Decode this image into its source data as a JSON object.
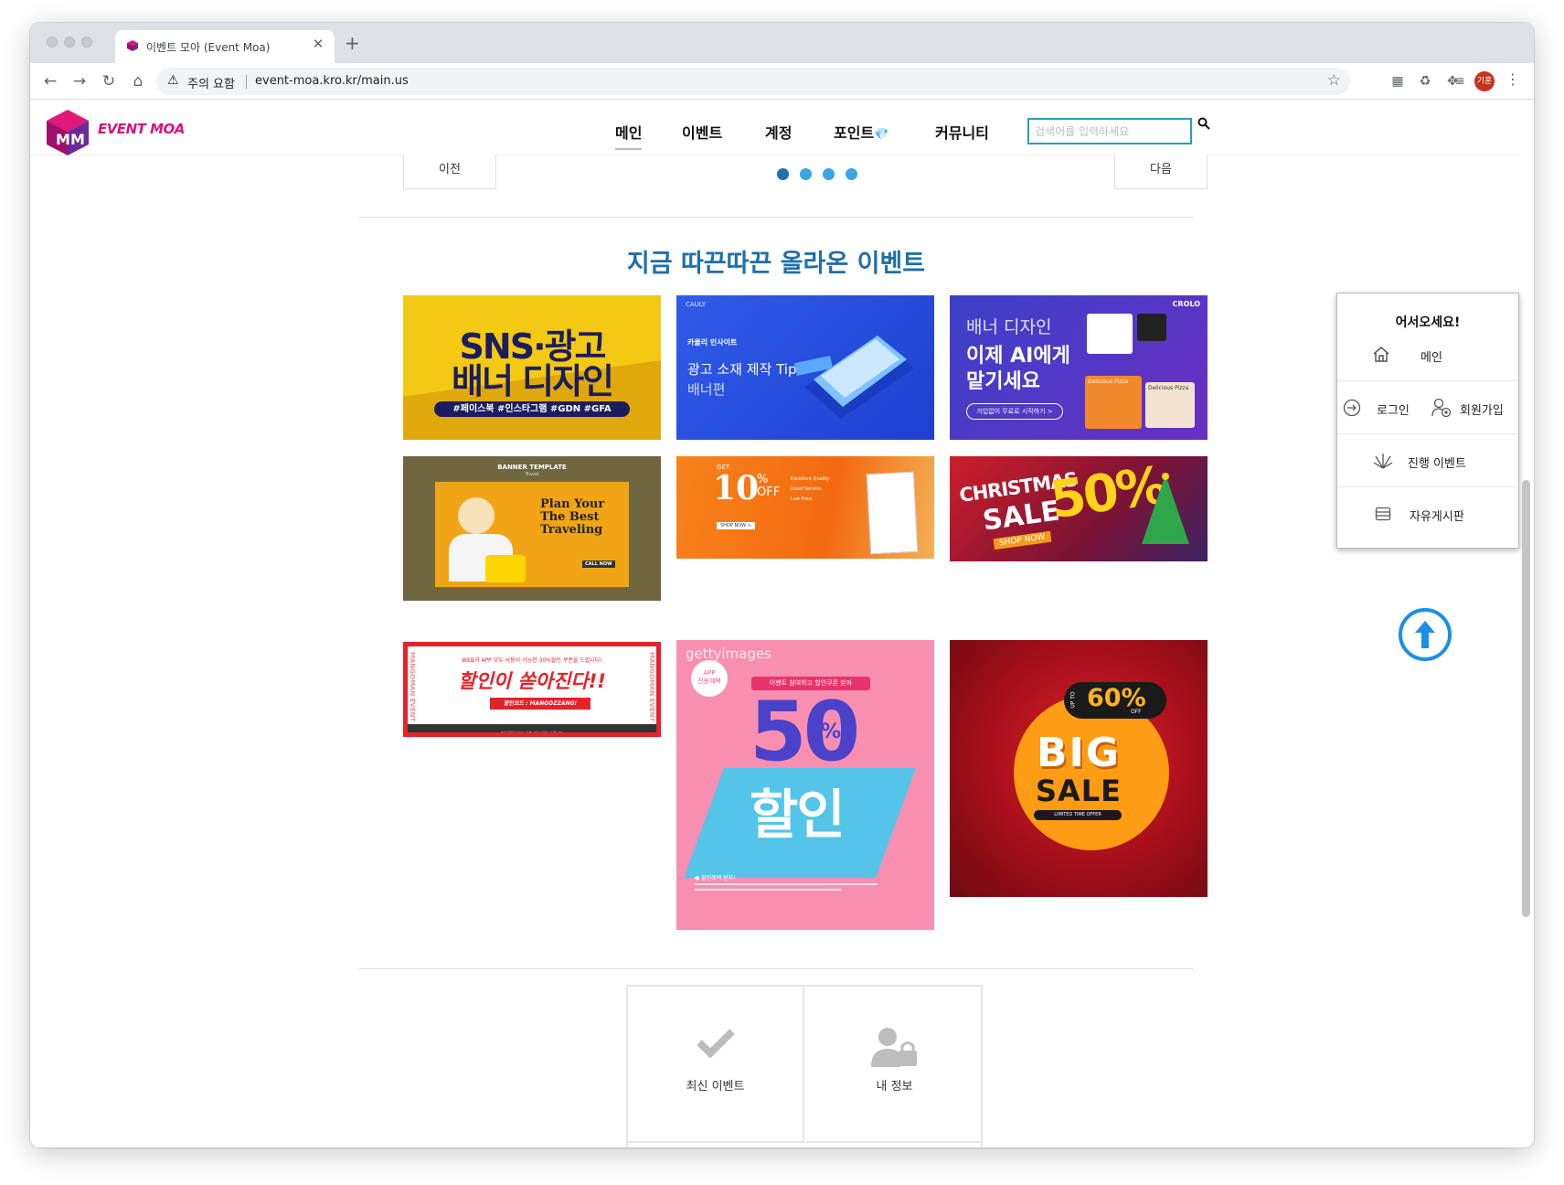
{
  "browser": {
    "tab_title": "이벤트 모아 (Event Moa)",
    "security_label": "주의 요함",
    "url": "event-moa.kro.kr/main.us",
    "avatar_text": "기훈"
  },
  "site": {
    "logo_text": "EVENT MOA",
    "nav": [
      "메인",
      "이벤트",
      "계정",
      "포인트",
      "커뮤니티"
    ],
    "search_placeholder": "검색어를 입력하세요"
  },
  "slider": {
    "prev_label": "이전",
    "next_label": "다음",
    "dots": 4,
    "active_dot": 0
  },
  "section_title": "지금 따끈따끈 올라온 이벤트",
  "banners": {
    "b1": {
      "line1": "SNS·광고",
      "line2": "배너 디자인",
      "tags": "#페이스북 #인스타그램 #GDN #GFA"
    },
    "b2": {
      "brand": "CAULY",
      "kicker": "카울리 인사이트",
      "title": "광고 소재 제작 Tip",
      "sub": "배너편"
    },
    "b3": {
      "brand": "CROLO",
      "line1": "배너 디자인",
      "line2": "이제 AI에게",
      "line3": "맡기세요",
      "cta": "가입없이 무료로 시작하기 >",
      "food1": "Delicious Pizza",
      "food2": "Delicious Pizza"
    },
    "b4": {
      "header": "BANNER TEMPLATE",
      "sub": "Travel",
      "title": "Plan Your The Best Traveling",
      "cta": "CALL NOW"
    },
    "b5": {
      "get": "GET",
      "pct": "10",
      "unit": "%",
      "off": "OFF",
      "bullets": [
        "Excellent Quality",
        "Good Service",
        "Low Price"
      ],
      "cta": "SHOP NOW >"
    },
    "b6": {
      "line1": "CHRISTMAS",
      "line2": "SALE",
      "pct": "50%",
      "cta": "SHOP NOW"
    },
    "b7": {
      "top": "WEB과 APP 모두 사용이 가능한 30%할인 쿠폰을 드립니다!",
      "title": "할인이 쏟아진다!!",
      "code": "할인코드 : MANGOZZANG!",
      "side_left": "MANGOMAN EVENT",
      "side_right": "MANGOMAN EVENT",
      "foot": "*각 할인코드는 우측 가능 여부 나옵니다"
    },
    "b8": {
      "brand": "gettyimages",
      "badge1": "APP",
      "badge2": "전용혜택",
      "ribbon": "이벤트 참여하고 할인쿠폰 받자",
      "big": "50",
      "pct": "%",
      "word": "할인",
      "note": "● 할인혜택 받자!"
    },
    "b9": {
      "upto": "UP TO",
      "pct": "60%",
      "off": "OFF",
      "big": "BIG",
      "sale": "SALE",
      "tag": "LIMITED TIME OFFER"
    }
  },
  "quick_links": [
    {
      "label": "최신 이벤트",
      "icon": "check-icon"
    },
    {
      "label": "내 정보",
      "icon": "user-lock-icon"
    }
  ],
  "side_panel": {
    "title": "어서오세요!",
    "main": "메인",
    "login": "로그인",
    "signup": "회원가입",
    "events": "진행 이벤트",
    "board": "자유게시판"
  },
  "colors": {
    "accent": "#1f6fa8",
    "search_border": "#2a9fba",
    "scroll_top": "#1a8fe5",
    "logo": "#d7137e"
  }
}
